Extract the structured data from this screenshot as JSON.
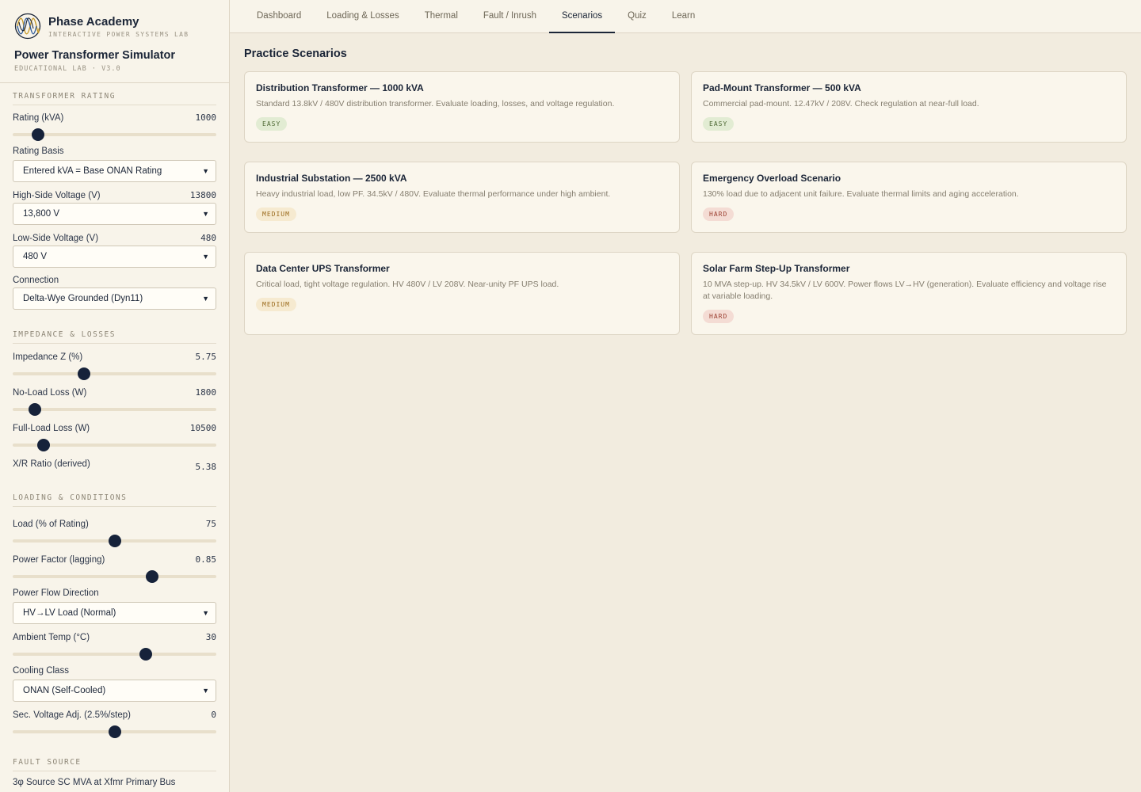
{
  "brand": {
    "name": "Phase Academy",
    "tagline": "INTERACTIVE POWER SYSTEMS LAB",
    "app_title": "Power Transformer Simulator",
    "version": "EDUCATIONAL LAB · V3.0"
  },
  "tabs": [
    {
      "label": "Dashboard",
      "active": false
    },
    {
      "label": "Loading & Losses",
      "active": false
    },
    {
      "label": "Thermal",
      "active": false
    },
    {
      "label": "Fault / Inrush",
      "active": false
    },
    {
      "label": "Scenarios",
      "active": true
    },
    {
      "label": "Quiz",
      "active": false
    },
    {
      "label": "Learn",
      "active": false
    }
  ],
  "sidebar": {
    "rating": {
      "heading": "TRANSFORMER RATING",
      "rating_kva": {
        "label": "Rating (kVA)",
        "value": "1000"
      },
      "rating_basis": {
        "label": "Rating Basis",
        "selected": "Entered kVA = Base ONAN Rating"
      },
      "hv": {
        "label": "High-Side Voltage (V)",
        "value": "13800",
        "selected": "13,800 V"
      },
      "lv": {
        "label": "Low-Side Voltage (V)",
        "value": "480",
        "selected": "480 V"
      },
      "connection": {
        "label": "Connection",
        "selected": "Delta-Wye Grounded (Dyn11)"
      }
    },
    "impedance": {
      "heading": "IMPEDANCE & LOSSES",
      "z": {
        "label": "Impedance Z (%)",
        "value": "5.75"
      },
      "noload": {
        "label": "No-Load Loss (W)",
        "value": "1800"
      },
      "fullload": {
        "label": "Full-Load Loss (W)",
        "value": "10500"
      },
      "xr": {
        "label": "X/R Ratio (derived)",
        "value": "5.38"
      }
    },
    "loading": {
      "heading": "LOADING & CONDITIONS",
      "load": {
        "label": "Load (% of Rating)",
        "value": "75"
      },
      "pf": {
        "label": "Power Factor (lagging)",
        "value": "0.85"
      },
      "flow": {
        "label": "Power Flow Direction",
        "selected": "HV→LV Load (Normal)"
      },
      "ambient": {
        "label": "Ambient Temp (°C)",
        "value": "30"
      },
      "cooling": {
        "label": "Cooling Class",
        "selected": "ONAN (Self-Cooled)"
      },
      "secadj": {
        "label": "Sec. Voltage Adj. (2.5%/step)",
        "value": "0"
      }
    },
    "fault": {
      "heading": "FAULT SOURCE",
      "source": {
        "label": "3φ Source SC MVA at Xfmr Primary Bus"
      }
    },
    "slider_positions": {
      "rating_kva": 0.125,
      "z": 0.35,
      "noload": 0.11,
      "fullload": 0.15,
      "load": 0.5,
      "pf": 0.685,
      "ambient": 0.655,
      "secadj": 0.5
    }
  },
  "main": {
    "title": "Practice Scenarios",
    "scenarios": [
      {
        "title": "Distribution Transformer — 1000 kVA",
        "desc": "Standard 13.8kV / 480V distribution transformer. Evaluate loading, losses, and voltage regulation.",
        "difficulty": "EASY"
      },
      {
        "title": "Pad-Mount Transformer — 500 kVA",
        "desc": "Commercial pad-mount. 12.47kV / 208V. Check regulation at near-full load.",
        "difficulty": "EASY"
      },
      {
        "title": "Industrial Substation — 2500 kVA",
        "desc": "Heavy industrial load, low PF. 34.5kV / 480V. Evaluate thermal performance under high ambient.",
        "difficulty": "MEDIUM"
      },
      {
        "title": "Emergency Overload Scenario",
        "desc": "130% load due to adjacent unit failure. Evaluate thermal limits and aging acceleration.",
        "difficulty": "HARD"
      },
      {
        "title": "Data Center UPS Transformer",
        "desc": "Critical load, tight voltage regulation. HV 480V / LV 208V. Near-unity PF UPS load.",
        "difficulty": "MEDIUM"
      },
      {
        "title": "Solar Farm Step-Up Transformer",
        "desc": "10 MVA step-up. HV 34.5kV / LV 600V. Power flows LV→HV (generation). Evaluate efficiency and voltage rise at variable loading.",
        "difficulty": "HARD"
      }
    ]
  },
  "colors": {
    "accent": "#16223a",
    "background": "#f2ecdf",
    "panel": "#f8f4ea"
  },
  "icons": {
    "logo": "sine-wave-logo-icon",
    "select": "chevron-down-icon"
  }
}
